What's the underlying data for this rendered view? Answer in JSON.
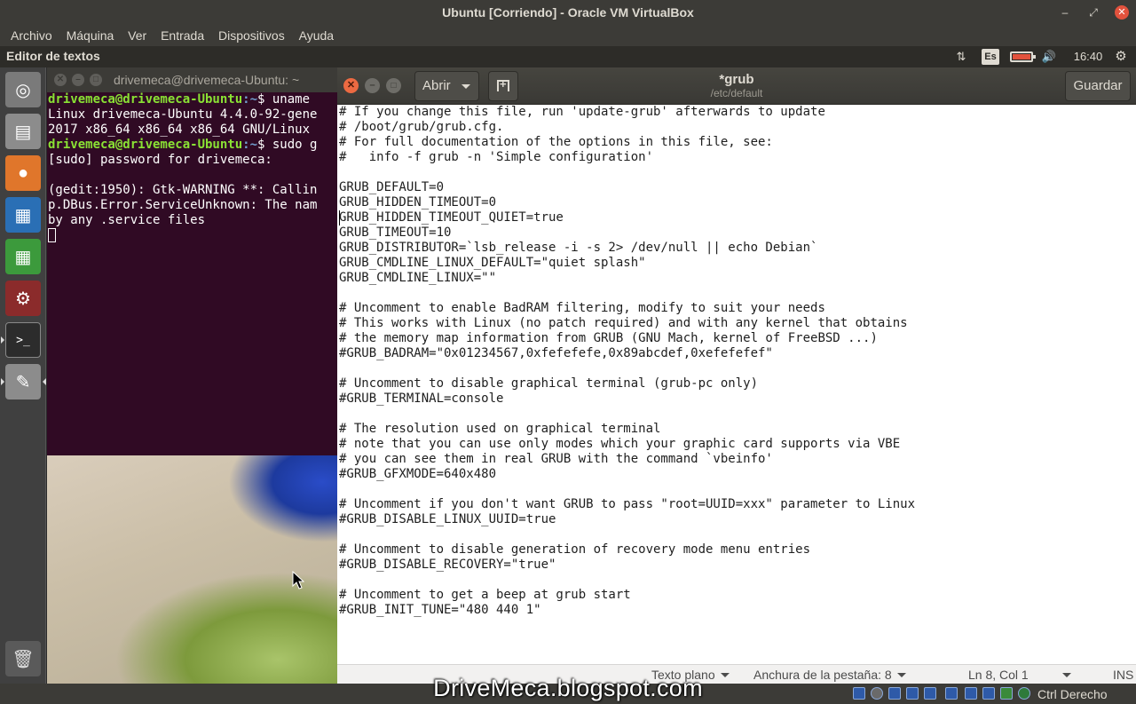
{
  "vbox": {
    "title": "Ubuntu [Corriendo] - Oracle VM VirtualBox",
    "menu": [
      "Archivo",
      "Máquina",
      "Ver",
      "Entrada",
      "Dispositivos",
      "Ayuda"
    ],
    "host_key": "Ctrl Derecho"
  },
  "panel": {
    "app_title": "Editor de textos",
    "lang": "Es",
    "clock": "16:40",
    "network_glyph": "⇅",
    "volume_glyph": "🔊",
    "gear_glyph": "⚙"
  },
  "launcher": {
    "items": [
      {
        "name": "ubuntu-dash-icon",
        "glyph": "◎",
        "bg": "#7a7a7a"
      },
      {
        "name": "files-icon",
        "glyph": "▤",
        "bg": "#8c8c8c"
      },
      {
        "name": "firefox-icon",
        "glyph": "●",
        "bg": "#e0762b"
      },
      {
        "name": "libreoffice-writer-icon",
        "glyph": "▦",
        "bg": "#2a6fb5"
      },
      {
        "name": "libreoffice-calc-icon",
        "glyph": "▦",
        "bg": "#3c9a3c"
      },
      {
        "name": "system-settings-icon",
        "glyph": "⚙",
        "bg": "#8b2b2b"
      },
      {
        "name": "terminal-icon",
        "glyph": ">_",
        "bg": "#2c2c2c"
      },
      {
        "name": "text-editor-icon",
        "glyph": "✎",
        "bg": "#8c8c8c"
      }
    ],
    "trash_glyph": "🗑"
  },
  "terminal": {
    "title": "drivemeca@drivemeca-Ubuntu: ~",
    "prompt_user": "drivemeca@drivemeca-Ubuntu",
    "prompt_path": ":~",
    "cmd1": "$ uname",
    "out1": "Linux drivemeca-Ubuntu 4.4.0-92-gene",
    "out2": "2017 x86_64 x86_64 x86_64 GNU/Linux",
    "cmd2": "$ sudo g",
    "out3": "[sudo] password for drivemeca:",
    "out4": "",
    "out5": "(gedit:1950): Gtk-WARNING **: Callin",
    "out6": "p.DBus.Error.ServiceUnknown: The nam",
    "out7": "by any .service files"
  },
  "gedit": {
    "open_label": "Abrir",
    "save_label": "Guardar",
    "doc_title": "*grub",
    "doc_path": "/etc/default",
    "lines": [
      "# If you change this file, run 'update-grub' afterwards to update",
      "# /boot/grub/grub.cfg.",
      "# For full documentation of the options in this file, see:",
      "#   info -f grub -n 'Simple configuration'",
      "",
      "GRUB_DEFAULT=0",
      "GRUB_HIDDEN_TIMEOUT=0",
      "GRUB_HIDDEN_TIMEOUT_QUIET=true",
      "GRUB_TIMEOUT=10",
      "GRUB_DISTRIBUTOR=`lsb_release -i -s 2> /dev/null || echo Debian`",
      "GRUB_CMDLINE_LINUX_DEFAULT=\"quiet splash\"",
      "GRUB_CMDLINE_LINUX=\"\"",
      "",
      "# Uncomment to enable BadRAM filtering, modify to suit your needs",
      "# This works with Linux (no patch required) and with any kernel that obtains",
      "# the memory map information from GRUB (GNU Mach, kernel of FreeBSD ...)",
      "#GRUB_BADRAM=\"0x01234567,0xfefefefe,0x89abcdef,0xefefefef\"",
      "",
      "# Uncomment to disable graphical terminal (grub-pc only)",
      "#GRUB_TERMINAL=console",
      "",
      "# The resolution used on graphical terminal",
      "# note that you can use only modes which your graphic card supports via VBE",
      "# you can see them in real GRUB with the command `vbeinfo'",
      "#GRUB_GFXMODE=640x480",
      "",
      "# Uncomment if you don't want GRUB to pass \"root=UUID=xxx\" parameter to Linux",
      "#GRUB_DISABLE_LINUX_UUID=true",
      "",
      "# Uncomment to disable generation of recovery mode menu entries",
      "#GRUB_DISABLE_RECOVERY=\"true\"",
      "",
      "# Uncomment to get a beep at grub start",
      "#GRUB_INIT_TUNE=\"480 440 1\""
    ],
    "status": {
      "language": "Texto plano",
      "tab_width": "Anchura de la pestaña: 8",
      "position": "Ln 8, Col 1",
      "mode": "INS"
    }
  },
  "watermark": "DriveMeca.blogspot.com",
  "colors": {
    "terminal_bg": "#300a24",
    "prompt_user": "#8ae234",
    "prompt_path": "#729fcf",
    "close_button": "#ec6a42"
  }
}
